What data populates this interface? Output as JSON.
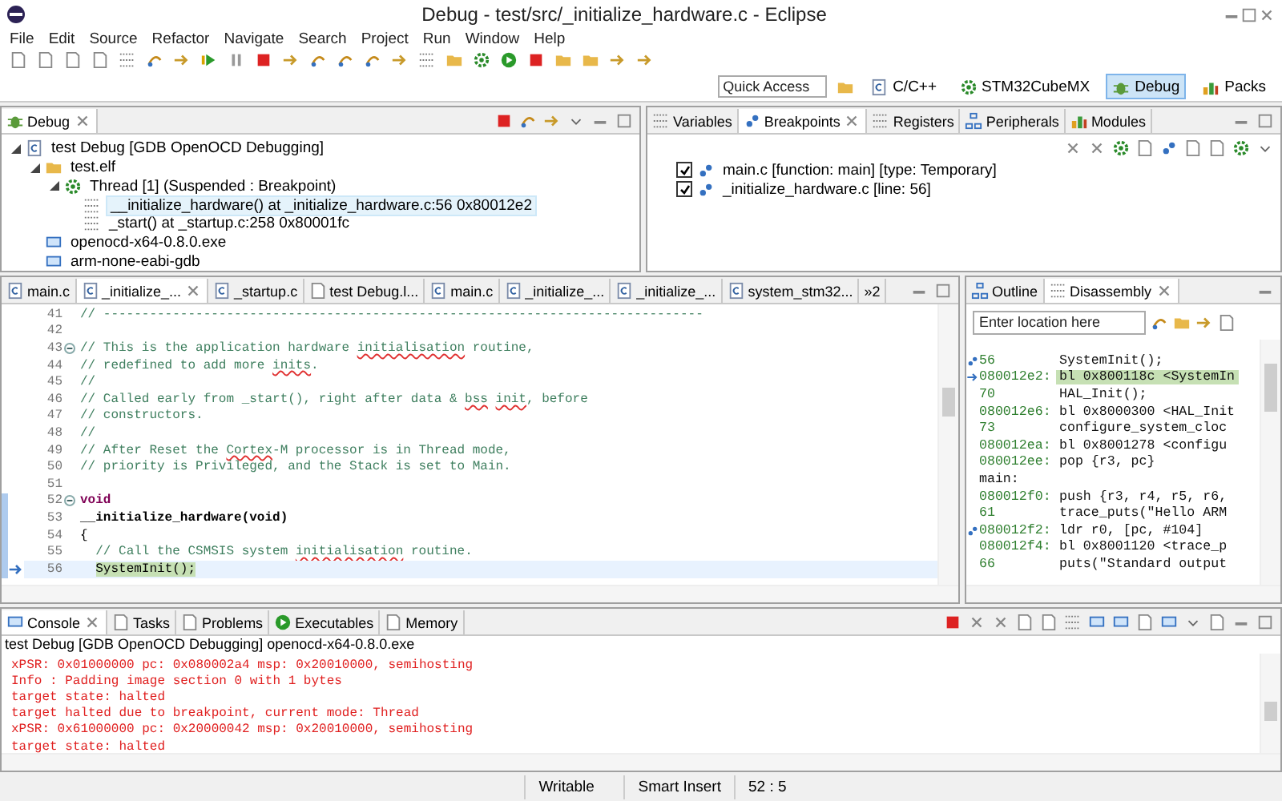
{
  "window": {
    "title": "Debug - test/src/_initialize_hardware.c - Eclipse"
  },
  "menu": [
    "File",
    "Edit",
    "Source",
    "Refactor",
    "Navigate",
    "Search",
    "Project",
    "Run",
    "Window",
    "Help"
  ],
  "quick_access": {
    "placeholder": "Quick Access"
  },
  "perspectives": [
    {
      "label": "C/C++",
      "selected": false
    },
    {
      "label": "STM32CubeMX",
      "selected": false
    },
    {
      "label": "Debug",
      "selected": true
    },
    {
      "label": "Packs",
      "selected": false
    }
  ],
  "debug_view": {
    "tabs": [
      {
        "label": "Debug",
        "selected": true
      }
    ],
    "tree": [
      {
        "label": "test Debug [GDB OpenOCD Debugging]",
        "kind": "launch",
        "selected": false,
        "expanded": true,
        "children": [
          {
            "label": "test.elf",
            "kind": "process",
            "selected": false,
            "expanded": true,
            "children": [
              {
                "label": "Thread [1] (Suspended : Breakpoint)",
                "kind": "thread",
                "selected": false,
                "expanded": true,
                "children": [
                  {
                    "label": "__initialize_hardware() at _initialize_hardware.c:56 0x80012e2",
                    "kind": "frame",
                    "selected": true
                  },
                  {
                    "label": "_start() at _startup.c:258 0x80001fc",
                    "kind": "frame",
                    "selected": false
                  }
                ]
              }
            ]
          },
          {
            "label": "openocd-x64-0.8.0.exe",
            "kind": "exe",
            "selected": false
          },
          {
            "label": "arm-none-eabi-gdb",
            "kind": "exe",
            "selected": false
          }
        ]
      }
    ]
  },
  "breakpoints_view": {
    "tabs": [
      {
        "label": "Variables",
        "selected": false
      },
      {
        "label": "Breakpoints",
        "selected": true
      },
      {
        "label": "Registers",
        "selected": false
      },
      {
        "label": "Peripherals",
        "selected": false
      },
      {
        "label": "Modules",
        "selected": false
      }
    ],
    "items": [
      {
        "label": "main.c [function: main] [type: Temporary]",
        "checked": true
      },
      {
        "label": "_initialize_hardware.c [line: 56]",
        "checked": true
      }
    ]
  },
  "editor": {
    "tabs": [
      {
        "label": "main.c",
        "selected": false
      },
      {
        "label": "_initialize_...",
        "selected": true
      },
      {
        "label": "_startup.c",
        "selected": false
      },
      {
        "label": "test Debug.l...",
        "selected": false
      },
      {
        "label": "main.c",
        "selected": false
      },
      {
        "label": "_initialize_...",
        "selected": false
      },
      {
        "label": "_initialize_...",
        "selected": false
      },
      {
        "label": "system_stm32...",
        "selected": false
      }
    ],
    "overflow": "»2",
    "lines": [
      {
        "number": "41",
        "segments": [
          {
            "text": "// ------------------------------------------------------------------------------",
            "kind": "comment"
          }
        ]
      },
      {
        "number": "42"
      },
      {
        "number": "43",
        "fold": true,
        "segments": [
          {
            "text": "// This is the application hardware ",
            "kind": "comment"
          },
          {
            "text": "initialisation",
            "kind": "spell"
          },
          {
            "text": " routine,",
            "kind": "comment"
          }
        ]
      },
      {
        "number": "44",
        "segments": [
          {
            "text": "// redefined to add more ",
            "kind": "comment"
          },
          {
            "text": "inits",
            "kind": "spell"
          },
          {
            "text": ".",
            "kind": "comment"
          }
        ]
      },
      {
        "number": "45",
        "segments": [
          {
            "text": "//",
            "kind": "comment"
          }
        ]
      },
      {
        "number": "46",
        "segments": [
          {
            "text": "// Called early from _start(), right after data & ",
            "kind": "comment"
          },
          {
            "text": "bss",
            "kind": "spell"
          },
          {
            "text": " init",
            "kind": "spell"
          },
          {
            "text": ", before",
            "kind": "comment"
          }
        ]
      },
      {
        "number": "47",
        "segments": [
          {
            "text": "// constructors.",
            "kind": "comment"
          }
        ]
      },
      {
        "number": "48",
        "segments": [
          {
            "text": "//",
            "kind": "comment"
          }
        ]
      },
      {
        "number": "49",
        "segments": [
          {
            "text": "// After Reset the ",
            "kind": "comment"
          },
          {
            "text": "Cortex",
            "kind": "spell"
          },
          {
            "text": "-M processor is in Thread mode,",
            "kind": "comment"
          }
        ]
      },
      {
        "number": "50",
        "segments": [
          {
            "text": "// priority is Privileged, and the Stack is set to Main.",
            "kind": "comment"
          }
        ]
      },
      {
        "number": "51"
      },
      {
        "number": "52",
        "fold": true,
        "in_range": true,
        "segments": [
          {
            "text": "void",
            "kind": "keyword"
          }
        ]
      },
      {
        "number": "53",
        "in_range": true,
        "segments": [
          {
            "text": "__initialize_hardware(void)",
            "kind": "bold"
          }
        ]
      },
      {
        "number": "54",
        "in_range": true,
        "segments": [
          {
            "text": "{",
            "kind": "plain"
          }
        ]
      },
      {
        "number": "55",
        "in_range": true,
        "segments": [
          {
            "text": "  // Call the CSMSIS system ",
            "kind": "comment"
          },
          {
            "text": "initialisation",
            "kind": "spell"
          },
          {
            "text": " routine.",
            "kind": "comment"
          }
        ]
      },
      {
        "number": "56",
        "in_range": true,
        "current": true,
        "segments": [
          {
            "text": "  SystemInit();",
            "kind": "pc"
          }
        ]
      }
    ]
  },
  "disassembly_view": {
    "tabs": [
      {
        "label": "Outline",
        "selected": false
      },
      {
        "label": "Disassembly",
        "selected": true
      }
    ],
    "location": {
      "placeholder": "Enter location here"
    },
    "rows": [
      {
        "address": "56",
        "code": "SystemInit();",
        "breakpoint": true,
        "current": false
      },
      {
        "address": "080012e2:",
        "code": "bl 0x800118c <SystemIn",
        "breakpoint": false,
        "current": true
      },
      {
        "address": "70",
        "code": "HAL_Init();",
        "breakpoint": false,
        "current": false
      },
      {
        "address": "080012e6:",
        "code": "bl 0x8000300 <HAL_Init",
        "breakpoint": false,
        "current": false
      },
      {
        "address": "73",
        "code": "configure_system_cloc",
        "breakpoint": false,
        "current": false
      },
      {
        "address": "080012ea:",
        "code": "bl 0x8001278 <configu",
        "breakpoint": false,
        "current": false
      },
      {
        "address": "080012ee:",
        "code": "pop {r3, pc}",
        "breakpoint": false,
        "current": false
      },
      {
        "label": "main:",
        "breakpoint": false,
        "current": false
      },
      {
        "address": "080012f0:",
        "code": "push {r3, r4, r5, r6,",
        "breakpoint": false,
        "current": false
      },
      {
        "address": "61",
        "code": "trace_puts(\"Hello ARM",
        "breakpoint": false,
        "current": false
      },
      {
        "address": "080012f2:",
        "code": "ldr r0, [pc, #104]",
        "breakpoint": true,
        "current": false
      },
      {
        "address": "080012f4:",
        "code": "bl 0x8001120 <trace_p",
        "breakpoint": false,
        "current": false
      },
      {
        "address": "66",
        "code": "puts(\"Standard output",
        "breakpoint": false,
        "current": false
      }
    ]
  },
  "console_view": {
    "tabs": [
      {
        "label": "Console",
        "selected": true
      },
      {
        "label": "Tasks",
        "selected": false
      },
      {
        "label": "Problems",
        "selected": false
      },
      {
        "label": "Executables",
        "selected": false
      },
      {
        "label": "Memory",
        "selected": false
      }
    ],
    "header": "test Debug [GDB OpenOCD Debugging] openocd-x64-0.8.0.exe",
    "lines": [
      {
        "text": "xPSR: 0x01000000 pc: 0x080002a4 msp: 0x20010000, semihosting",
        "kind": "error"
      },
      {
        "text": "Info : Padding image section 0 with 1 bytes",
        "kind": "error"
      },
      {
        "text": "target state: halted",
        "kind": "error"
      },
      {
        "text": "target halted due to breakpoint, current mode: Thread",
        "kind": "error"
      },
      {
        "text": "xPSR: 0x61000000 pc: 0x20000042 msp: 0x20010000, semihosting",
        "kind": "error"
      },
      {
        "text": "target state: halted",
        "kind": "error"
      }
    ]
  },
  "status_bar": [
    "Writable",
    "Smart Insert",
    "52 : 5"
  ]
}
